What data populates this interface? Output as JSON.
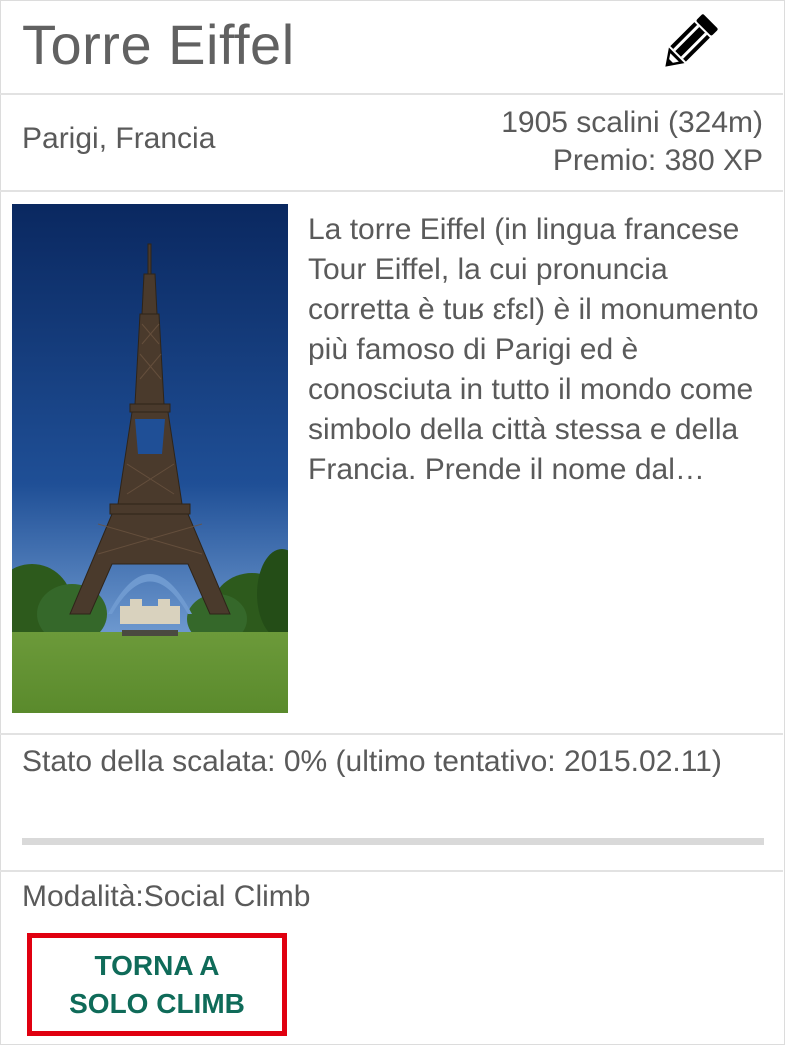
{
  "header": {
    "title": "Torre Eiffel",
    "edit_icon": "pencil-icon"
  },
  "meta": {
    "location": "Parigi, Francia",
    "steps": "1905 scalini (324m)",
    "reward": "Premio: 380 XP"
  },
  "content": {
    "description": "La torre Eiffel (in lingua francese Tour Eiffel, la cui pronuncia corretta è tuʁ ɛfɛl) è il monumento più famoso di Parigi ed è conosciuta in tutto il mondo come simbolo della città stessa e della Francia. Prende il nome dal…"
  },
  "status": {
    "text": "Stato della scalata: 0% (ultimo tentativo: 2015.02.11)",
    "progress": 0
  },
  "mode": {
    "text": "Modalità:Social Climb"
  },
  "action": {
    "label": "TORNA A\nSOLO CLIMB"
  },
  "colors": {
    "accent": "#0f6b59",
    "highlight_border": "#e00010",
    "divider": "#e2e2e2",
    "text": "#5a5a5a"
  }
}
